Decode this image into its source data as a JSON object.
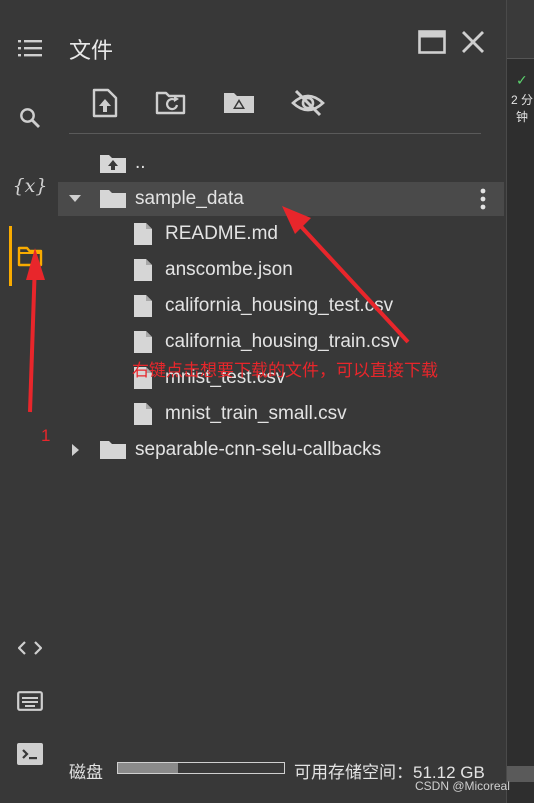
{
  "panel": {
    "title": "文件"
  },
  "rail": {
    "items": [
      {
        "name": "table-of-contents-icon"
      },
      {
        "name": "search-icon"
      },
      {
        "name": "variables-icon",
        "glyph": "{x}"
      },
      {
        "name": "files-icon",
        "active": true
      },
      {
        "name": "code-snippets-icon"
      },
      {
        "name": "command-palette-icon"
      },
      {
        "name": "terminal-icon"
      }
    ]
  },
  "toolbar": {
    "items": [
      "upload-icon",
      "refresh-folder-icon",
      "mount-drive-icon",
      "hide-hidden-files-icon"
    ]
  },
  "tree": {
    "parent_label": "..",
    "folders": [
      {
        "label": "sample_data",
        "expanded": true,
        "files": [
          "README.md",
          "anscombe.json",
          "california_housing_test.csv",
          "california_housing_train.csv",
          "mnist_test.csv",
          "mnist_train_small.csv"
        ]
      },
      {
        "label": "separable-cnn-selu-callbacks",
        "expanded": false
      }
    ]
  },
  "disk": {
    "label": "磁盘",
    "used_fraction": 0.36,
    "space_text": "可用存储空间：51.12 GB"
  },
  "status": {
    "text": "2 分钟"
  },
  "annotations": {
    "hint": "右键点击想要下载的文件，可以直接下载",
    "step_number": "1",
    "color": "#e8262b"
  },
  "watermark": "CSDN @Micoreal",
  "colors": {
    "background": "#383838",
    "accent": "#f9ab00",
    "selected_row": "#4a4a4a"
  }
}
